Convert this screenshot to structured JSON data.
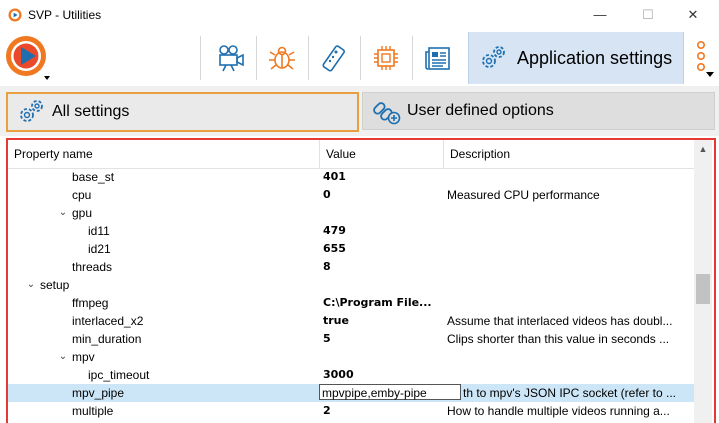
{
  "window": {
    "title": "SVP - Utilities",
    "minimize": "—",
    "maximize": "☐",
    "close": "✕"
  },
  "toolbar": {
    "active_tab_label": "Application settings",
    "buttons": [
      "video-camera-icon",
      "bug-icon",
      "remote-control-icon",
      "chip-icon",
      "newspaper-icon"
    ]
  },
  "tabs": {
    "all_settings": "All settings",
    "user_defined": "User defined options"
  },
  "table": {
    "headers": {
      "name": "Property name",
      "value": "Value",
      "description": "Description"
    },
    "rows": [
      {
        "name": "base_st",
        "value": "401",
        "desc": "",
        "indent": 4,
        "expand": ""
      },
      {
        "name": "cpu",
        "value": "0",
        "desc": "Measured CPU performance",
        "indent": 4,
        "expand": ""
      },
      {
        "name": "gpu",
        "value": "",
        "desc": "",
        "indent": 4,
        "expand": "v"
      },
      {
        "name": "id11",
        "value": "479",
        "desc": "",
        "indent": 5,
        "expand": ""
      },
      {
        "name": "id21",
        "value": "655",
        "desc": "",
        "indent": 5,
        "expand": ""
      },
      {
        "name": "threads",
        "value": "8",
        "desc": "",
        "indent": 4,
        "expand": ""
      },
      {
        "name": "setup",
        "value": "",
        "desc": "",
        "indent": 2,
        "expand": "v"
      },
      {
        "name": "ffmpeg",
        "value": "C:\\Program File...",
        "desc": "",
        "indent": 4,
        "expand": ""
      },
      {
        "name": "interlaced_x2",
        "value": "true",
        "desc": "Assume that interlaced videos has doubl...",
        "indent": 4,
        "expand": ""
      },
      {
        "name": "min_duration",
        "value": "5",
        "desc": "Clips shorter than this value in seconds ...",
        "indent": 4,
        "expand": ""
      },
      {
        "name": "mpv",
        "value": "",
        "desc": "",
        "indent": 4,
        "expand": "v"
      },
      {
        "name": "ipc_timeout",
        "value": "3000",
        "desc": "",
        "indent": 5,
        "expand": ""
      },
      {
        "name": "mpv_pipe",
        "value": "mpvpipe,emby-pipe",
        "desc": "th to mpv's JSON IPC socket (refer to ...",
        "indent": 4,
        "expand": "",
        "selected": true,
        "editing": true
      },
      {
        "name": "multiple",
        "value": "2",
        "desc": "How to handle multiple videos running a...",
        "indent": 4,
        "expand": ""
      }
    ]
  },
  "colors": {
    "accent_border": "#e53935",
    "active_tab_bg": "#d6e4f4",
    "orange_icon": "#f07820",
    "blue_icon": "#1e6fb0",
    "selected_row": "#cde6f7"
  }
}
